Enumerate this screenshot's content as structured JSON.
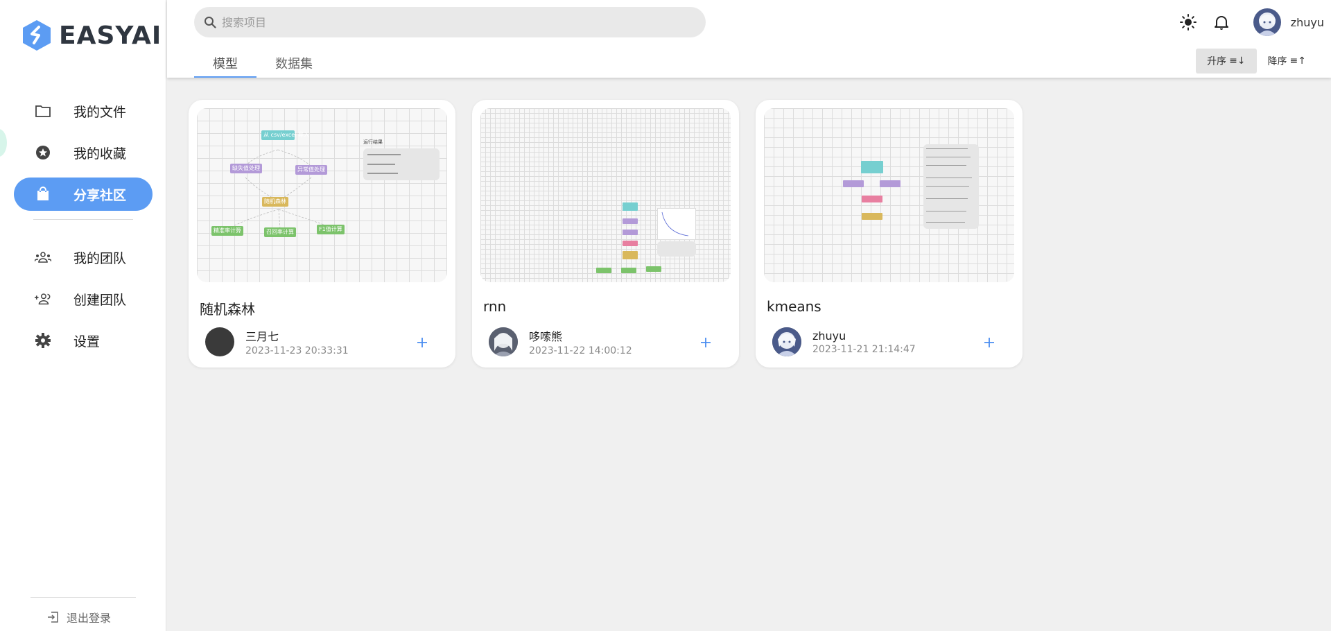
{
  "brand": {
    "name": "EASYAI",
    "color": "#5c9cf3"
  },
  "sidebar": {
    "items": [
      {
        "label": "我的文件",
        "icon": "folder-icon",
        "active": false
      },
      {
        "label": "我的收藏",
        "icon": "star-circle-icon",
        "active": false
      },
      {
        "label": "分享社区",
        "icon": "shopping-bag-icon",
        "active": true
      },
      {
        "label": "我的团队",
        "icon": "group-icon",
        "active": false
      },
      {
        "label": "创建团队",
        "icon": "group-add-icon",
        "active": false
      },
      {
        "label": "设置",
        "icon": "gear-icon",
        "active": false
      }
    ],
    "logout_label": "退出登录"
  },
  "header": {
    "search": {
      "placeholder": "搜索项目",
      "value": ""
    },
    "tabs": [
      {
        "label": "模型",
        "active": true
      },
      {
        "label": "数据集",
        "active": false
      }
    ],
    "username": "zhuyu",
    "sort": {
      "asc_label": "升序",
      "desc_label": "降序"
    }
  },
  "cards": [
    {
      "title": "随机森林",
      "author": "三月七",
      "date": "2023-11-23 20:33:31",
      "thumb": {
        "nodes": [
          "从 csv/excel 导入",
          "缺失值处理",
          "异常值处理",
          "随机森林",
          "精准率计算",
          "召回率计算",
          "F1值计算"
        ],
        "panel_title": "运行结果"
      }
    },
    {
      "title": "rnn",
      "author": "哆嗦熊",
      "date": "2023-11-22 14:00:12"
    },
    {
      "title": "kmeans",
      "author": "zhuyu",
      "date": "2023-11-21 21:14:47"
    }
  ]
}
